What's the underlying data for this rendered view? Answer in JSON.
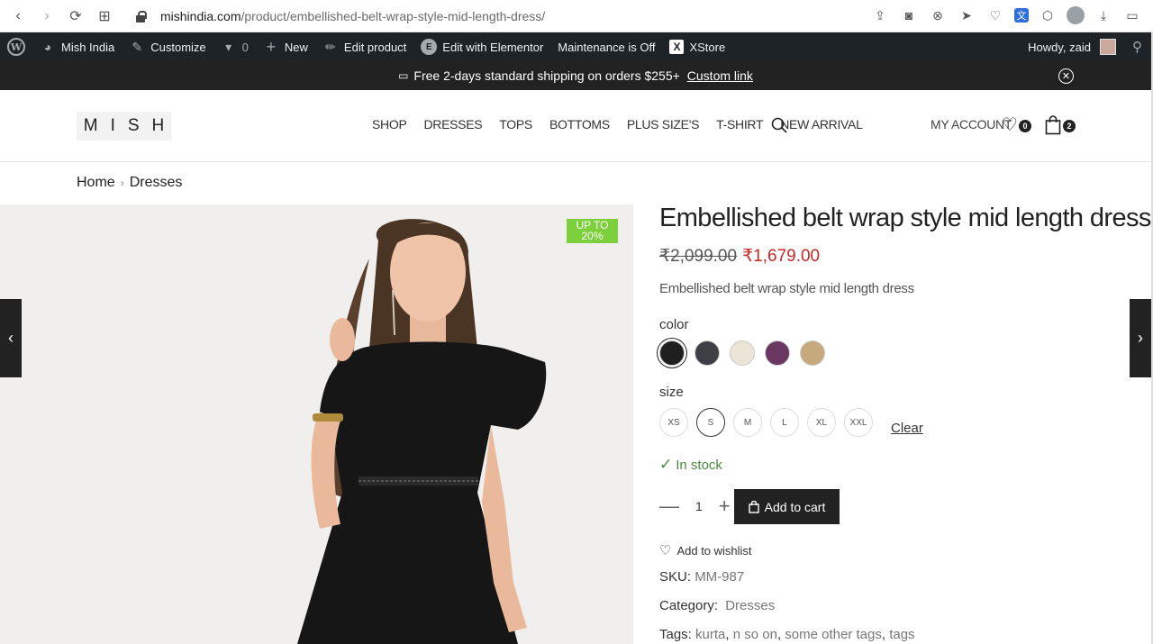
{
  "browser": {
    "url_host": "mishindia.com",
    "url_path": "/product/embellished-belt-wrap-style-mid-length-dress/"
  },
  "adminbar": {
    "site_name": "Mish India",
    "customize": "Customize",
    "comments_count": "0",
    "new": "New",
    "edit_product": "Edit product",
    "elementor": "Edit with Elementor",
    "maintenance": "Maintenance is Off",
    "xstore": "XStore",
    "howdy": "Howdy, zaid"
  },
  "promo": {
    "text": "Free 2-days standard shipping on orders $255+",
    "link": "Custom link"
  },
  "header": {
    "logo": "MISH",
    "nav": [
      "SHOP",
      "DRESSES",
      "TOPS",
      "BOTTOMS",
      "PLUS SIZE'S",
      "T-SHIRT",
      "NEW ARRIVAL"
    ],
    "my_account": "MY ACCOUNT",
    "wishlist_count": "0",
    "cart_count": "2"
  },
  "breadcrumb": {
    "home": "Home",
    "current": "Dresses"
  },
  "product": {
    "sale_badge_line1": "UP TO",
    "sale_badge_line2": "20%",
    "title": "Embellished belt wrap style mid length dress",
    "price_old": "₹2,099.00",
    "price_new": "₹1,679.00",
    "short_description": "Embellished belt wrap style mid length dress",
    "color_label": "color",
    "colors": [
      "#1f1f1f",
      "#3d3f44",
      "#ece4d6",
      "#6a3763",
      "#c6a97d"
    ],
    "selected_color_index": 0,
    "size_label": "size",
    "sizes": [
      "XS",
      "S",
      "M",
      "L",
      "XL",
      "XXL"
    ],
    "selected_size": "S",
    "clear": "Clear",
    "stock": "In stock",
    "quantity": "1",
    "add_to_cart": "Add to cart",
    "add_to_wishlist": "Add to wishlist",
    "sku_label": "SKU:",
    "sku": "MM-987",
    "category_label": "Category:",
    "category": "Dresses",
    "tags_label": "Tags:",
    "tags": [
      "kurta",
      "n so on",
      "some other tags",
      "tags"
    ]
  }
}
